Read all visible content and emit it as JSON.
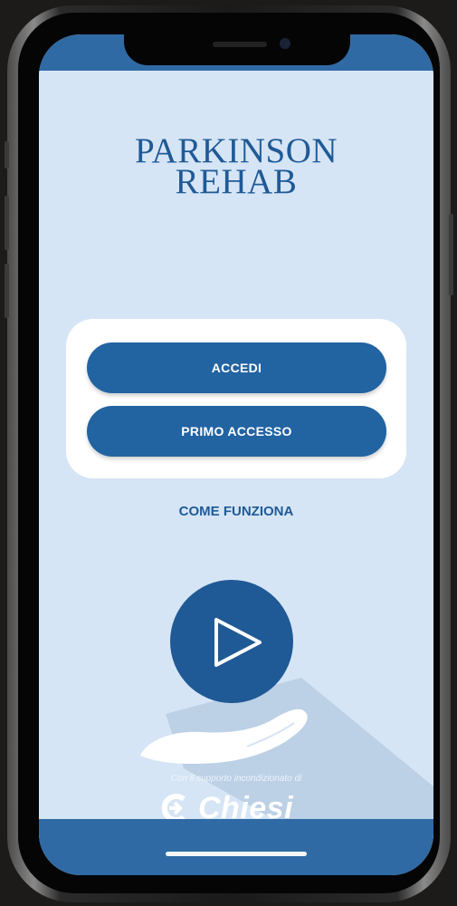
{
  "app": {
    "title_line1": "PARKINSON",
    "title_line2": "REHAB"
  },
  "actions": {
    "login_label": "ACCEDI",
    "first_access_label": "PRIMO ACCESSO",
    "how_it_works_label": "COME FUNZIONA"
  },
  "hero": {
    "icon": "play-in-hand-icon"
  },
  "footer": {
    "support_text": "Con il supporto incondizionato di",
    "brand_name": "Chiesi"
  },
  "colors": {
    "primary": "#2263a2",
    "bars": "#2f6aa4",
    "background": "#d6e5f5",
    "title": "#1f5a96"
  }
}
